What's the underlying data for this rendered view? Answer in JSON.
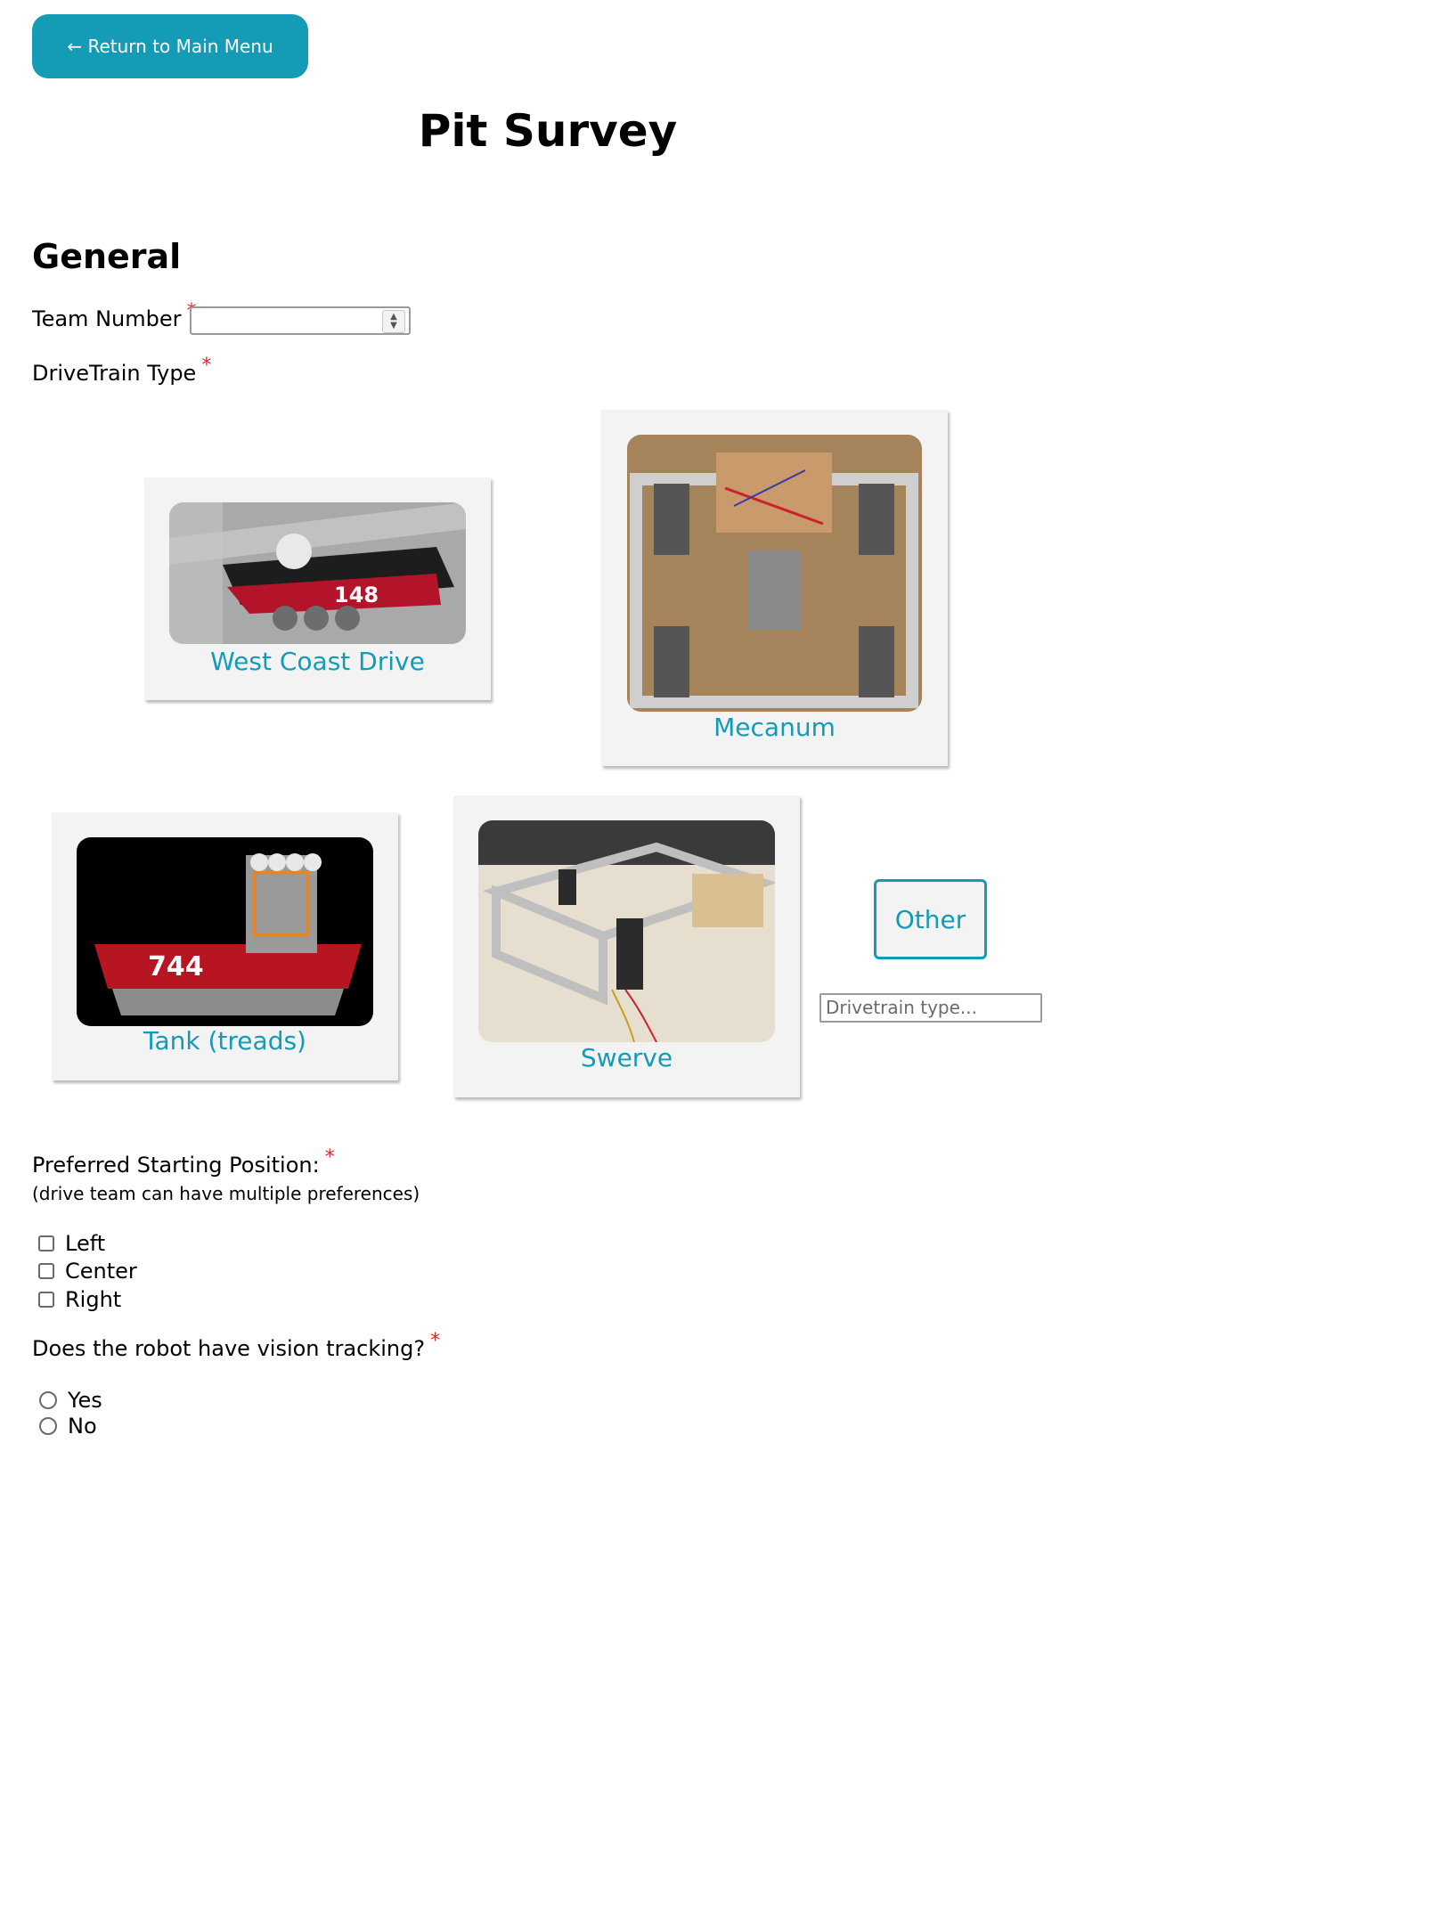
{
  "nav": {
    "return_label": "← Return to Main Menu"
  },
  "page": {
    "title": "Pit Survey"
  },
  "general": {
    "heading": "General",
    "team_number": {
      "label": "Team Number",
      "required_mark": "*",
      "value": ""
    },
    "drivetrain": {
      "label": "DriveTrain Type",
      "required_mark": "*",
      "options": [
        {
          "label": "West Coast Drive",
          "image_text": "148"
        },
        {
          "label": "Mecanum",
          "image_text": ""
        },
        {
          "label": "Tank (treads)",
          "image_text": "744"
        },
        {
          "label": "Swerve",
          "image_text": ""
        }
      ],
      "other_label": "Other",
      "other_placeholder": "Drivetrain type..."
    }
  },
  "starting_position": {
    "label": "Preferred Starting Position:",
    "required_mark": "*",
    "note": "(drive team can have multiple preferences)",
    "options": [
      "Left",
      "Center",
      "Right"
    ]
  },
  "vision": {
    "label": "Does the robot have vision tracking?",
    "required_mark": "*",
    "options": [
      "Yes",
      "No"
    ]
  },
  "colors": {
    "accent": "#149bb6",
    "required": "#e0262b",
    "card_bg": "#f3f3f3"
  }
}
